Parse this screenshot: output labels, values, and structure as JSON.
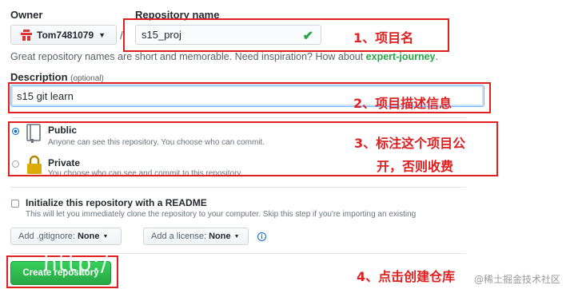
{
  "owner": {
    "label": "Owner",
    "name": "Tom7481079"
  },
  "repo": {
    "label": "Repository name",
    "value": "s15_proj",
    "separator": "/"
  },
  "hint": {
    "text": "Great repository names are short and memorable. Need inspiration? How about ",
    "suggestion": "expert-journey",
    "end": "."
  },
  "description": {
    "label": "Description",
    "optional": "(optional)",
    "value": "s15 git learn"
  },
  "visibility": {
    "public": {
      "title": "Public",
      "note": "Anyone can see this repository. You choose who can commit."
    },
    "private": {
      "title": "Private",
      "note": "You choose who can see and commit to this repository."
    }
  },
  "readme": {
    "title": "Initialize this repository with a README",
    "note": "This will let you immediately clone the repository to your computer. Skip this step if you're importing an existing"
  },
  "gitignore": {
    "label": "Add .gitignore:",
    "value": "None"
  },
  "license": {
    "label": "Add a license:",
    "value": "None"
  },
  "create_button": "Create repository",
  "annotations": {
    "a1": "1、项目名",
    "a2": "2、项目描述信息",
    "a3_line1": "3、标注这个项目公",
    "a3_line2": "开，否则收费",
    "a4": "4、点击创建仓库"
  },
  "watermark": "@稀土掘金技术社区",
  "url_watermark": "http:/",
  "colors": {
    "annotation": "#e02020",
    "create_button": "#28a745",
    "suggestion": "#28a745",
    "focus": "#79b8ff"
  }
}
